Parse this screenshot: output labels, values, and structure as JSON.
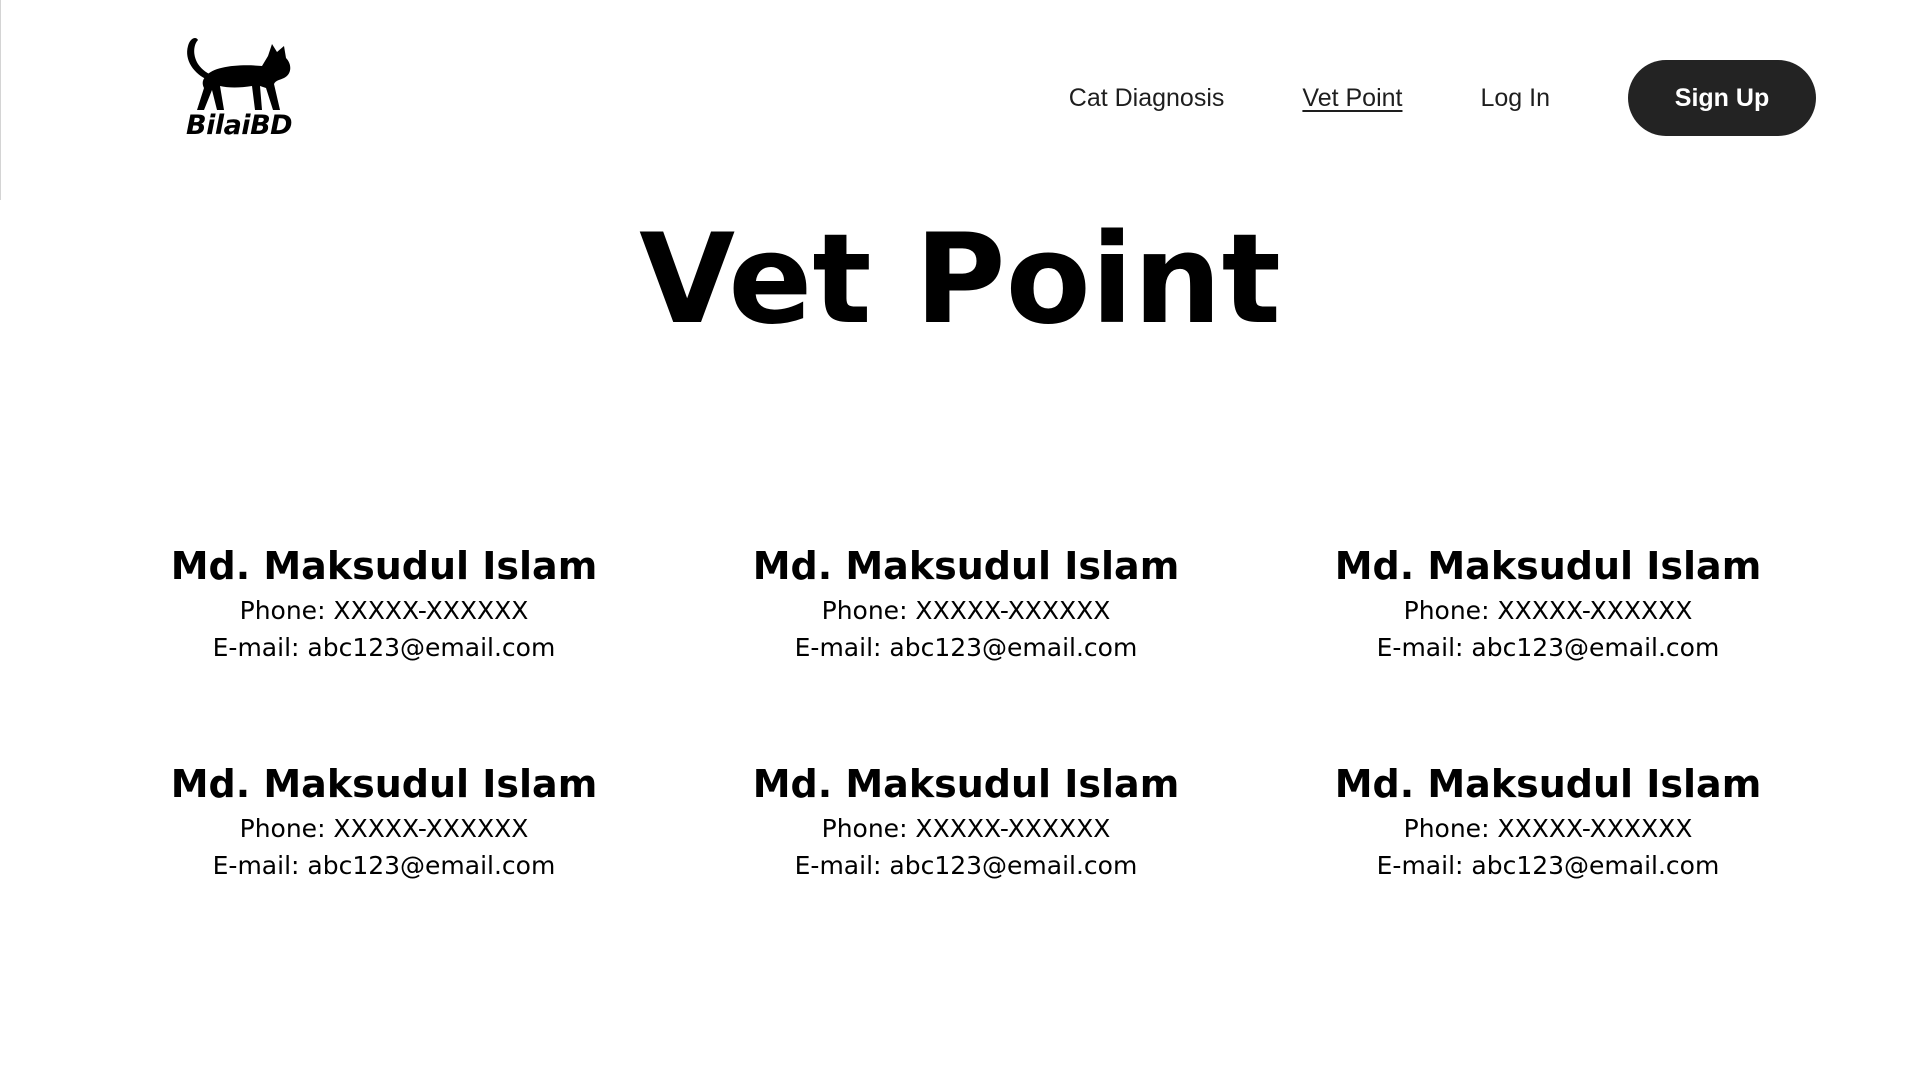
{
  "header": {
    "logo_text": "BilaiBD",
    "logo_icon": "cat-silhouette-icon",
    "nav": [
      {
        "label": "Cat Diagnosis",
        "active": false
      },
      {
        "label": "Vet Point",
        "active": true
      },
      {
        "label": "Log In",
        "active": false
      }
    ],
    "signup_label": "Sign Up",
    "signup_color": "#232323"
  },
  "main": {
    "title": "Vet Point",
    "vets": [
      {
        "name": "Md. Maksudul Islam",
        "phone": "Phone: XXXXX-XXXXXX",
        "email": "E-mail: abc123@email.com"
      },
      {
        "name": "Md. Maksudul Islam",
        "phone": "Phone: XXXXX-XXXXXX",
        "email": "E-mail: abc123@email.com"
      },
      {
        "name": "Md. Maksudul Islam",
        "phone": "Phone: XXXXX-XXXXXX",
        "email": "E-mail: abc123@email.com"
      },
      {
        "name": "Md. Maksudul Islam",
        "phone": "Phone: XXXXX-XXXXXX",
        "email": "E-mail: abc123@email.com"
      },
      {
        "name": "Md. Maksudul Islam",
        "phone": "Phone: XXXXX-XXXXXX",
        "email": "E-mail: abc123@email.com"
      },
      {
        "name": "Md. Maksudul Islam",
        "phone": "Phone: XXXXX-XXXXXX",
        "email": "E-mail: abc123@email.com"
      }
    ]
  }
}
